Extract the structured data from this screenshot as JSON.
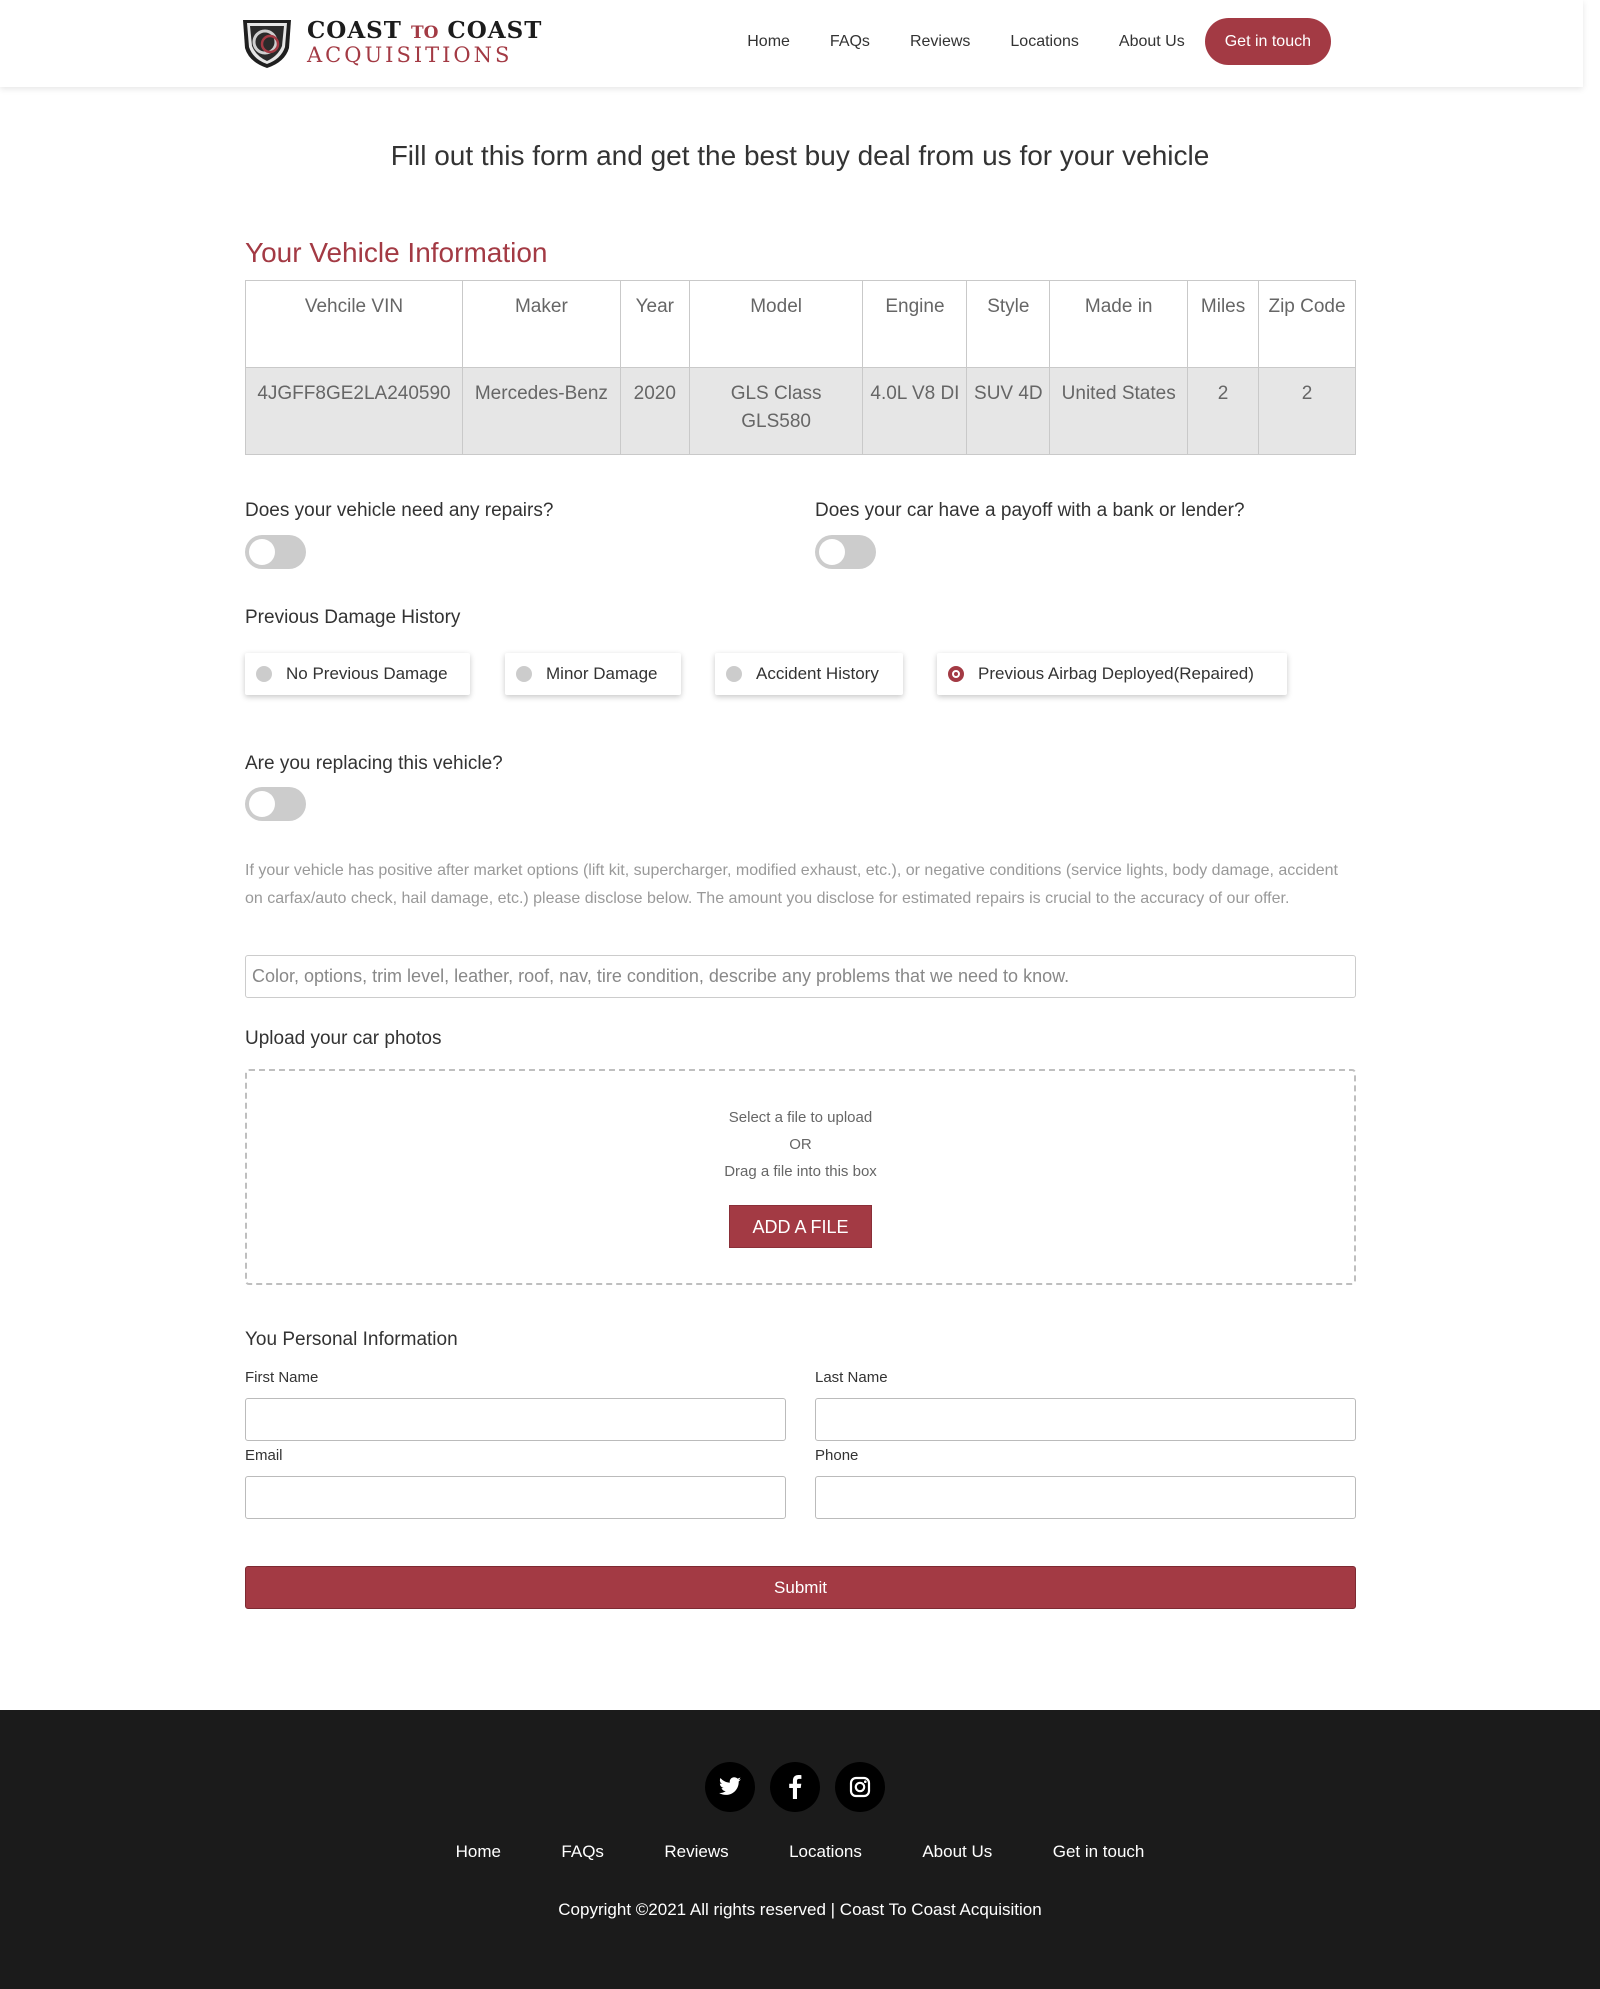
{
  "brand": {
    "line1_a": "COAST",
    "line1_to": "TO",
    "line1_b": "COAST",
    "line2": "ACQUISITIONS",
    "accent_color": "#a33a44"
  },
  "nav": {
    "items": [
      "Home",
      "FAQs",
      "Reviews",
      "Locations",
      "About Us"
    ],
    "cta": "Get in touch"
  },
  "headline": "Fill out this form and get the best buy deal from us for your vehicle",
  "vehicle": {
    "title": "Your Vehicle Information",
    "headers": [
      "Vehcile VIN",
      "Maker",
      "Year",
      "Model",
      "Engine",
      "Style",
      "Made in",
      "Miles",
      "Zip Code"
    ],
    "values": [
      "4JGFF8GE2LA240590",
      "Mercedes-Benz",
      "2020",
      "GLS Class GLS580",
      "4.0L V8 DI",
      "SUV 4D",
      "United States",
      "2",
      "2"
    ]
  },
  "questions": {
    "repairs": "Does your vehicle need any repairs?",
    "payoff": "Does your car have a payoff with a bank or lender?",
    "damage_title": "Previous Damage History",
    "replacing": "Are you replacing this vehicle?"
  },
  "damage_options": [
    {
      "label": "No Previous Damage",
      "selected": false
    },
    {
      "label": "Minor Damage",
      "selected": false
    },
    {
      "label": "Accident History",
      "selected": false
    },
    {
      "label": "Previous Airbag Deployed(Repaired)",
      "selected": true
    }
  ],
  "disclose_text": "If your vehicle has positive after market options (lift kit, supercharger, modified exhaust, etc.), or negative conditions (service lights, body damage, accident on carfax/auto check, hail damage, etc.) please disclose below. The amount you disclose for estimated repairs is crucial to the accuracy of our offer.",
  "description_placeholder": "Color, options, trim level, leather, roof, nav, tire condition, describe any problems that we need to know.",
  "upload": {
    "title": "Upload your car photos",
    "line1": "Select a file to upload",
    "line2": "OR",
    "line3": "Drag a file into this box",
    "button": "ADD A FILE"
  },
  "personal": {
    "title": "You Personal Information",
    "first_name": "First Name",
    "last_name": "Last Name",
    "email": "Email",
    "phone": "Phone",
    "submit": "Submit"
  },
  "footer": {
    "socials": [
      "twitter-icon",
      "facebook-icon",
      "instagram-icon"
    ],
    "nav": [
      "Home",
      "FAQs",
      "Reviews",
      "Locations",
      "About Us",
      "Get in touch"
    ],
    "copyright": "Copyright ©2021 All rights reserved | Coast To Coast Acquisition"
  }
}
